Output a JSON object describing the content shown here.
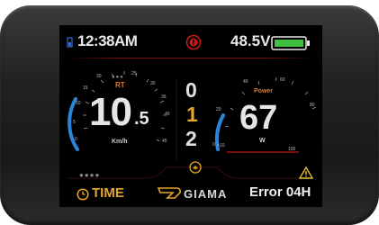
{
  "status_bar": {
    "time": "12:38AM",
    "voltage": "48.5V",
    "battery_color": "#3ec23e",
    "warning_color": "#d01818"
  },
  "speed_gauge": {
    "label": "RT",
    "value_int": "10",
    "value_dec": ".5",
    "unit": "Km/h",
    "scale_ticks": [
      "0",
      "5",
      "10",
      "15",
      "20",
      "25",
      "30",
      "35",
      "40",
      "45"
    ]
  },
  "assist_level": {
    "up": "0",
    "current": "1",
    "down": "2",
    "current_color": "#e6a42b"
  },
  "power_gauge": {
    "label": "Power",
    "value": "67",
    "unit": "W",
    "scale_ticks": [
      "0",
      "20",
      "40",
      "60",
      "80",
      "100"
    ],
    "multiplier": "×10"
  },
  "footer": {
    "time_label": "TIME",
    "brand": "GIAMA",
    "error": "Error 04H"
  },
  "colors": {
    "accent_orange": "#e07a28",
    "accent_gold": "#e6a42b",
    "gauge_blue": "#2a86d8"
  },
  "icons": [
    "battery-icon",
    "warning-icon",
    "clock-icon",
    "giama-logo",
    "alert-triangle-icon",
    "walk-assist-icon"
  ]
}
